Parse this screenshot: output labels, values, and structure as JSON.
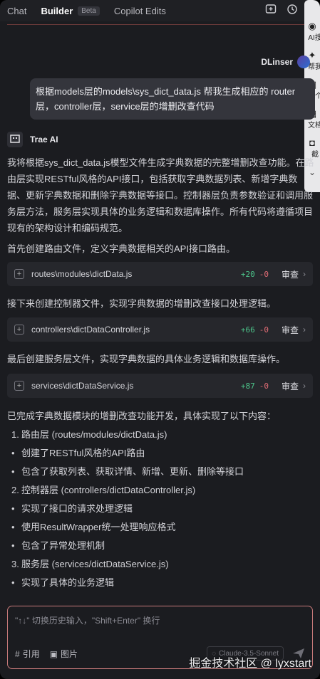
{
  "tabs": [
    {
      "label": "Chat"
    },
    {
      "label": "Builder",
      "badge": "Beta"
    },
    {
      "label": "Copilot Edits"
    }
  ],
  "top_icons": [
    "add-chat-icon",
    "history-icon"
  ],
  "side_panel": {
    "items": [
      {
        "icon": "ai-icon",
        "label": "AI搜"
      },
      {
        "icon": "help-icon",
        "label": "帮我"
      },
      {
        "icon": "image-icon",
        "label": "修个"
      },
      {
        "icon": "doc-icon",
        "label": "文档"
      },
      {
        "icon": "camera-icon",
        "label": "截"
      }
    ]
  },
  "user": {
    "name": "DLinser",
    "message": "根据models层的models\\sys_dict_data.js 帮我生成相应的 router层，controller层，service层的增删改查代码"
  },
  "assistant": {
    "name": "Trae AI",
    "intro": "我将根据sys_dict_data.js模型文件生成字典数据的完整增删改查功能。在路由层实现RESTful风格的API接口，包括获取字典数据列表、新增字典数据、更新字典数据和删除字典数据等接口。控制器层负责参数验证和调用服务层方法，服务层实现具体的业务逻辑和数据库操作。所有代码将遵循项目现有的架构设计和编码规范。",
    "step1": "首先创建路由文件，定义字典数据相关的API接口路由。",
    "step2": "接下来创建控制器文件，实现字典数据的增删改查接口处理逻辑。",
    "step3": "最后创建服务层文件，实现字典数据的具体业务逻辑和数据库操作。",
    "summary": "已完成字典数据模块的增删改查功能开发，具体实现了以下内容：",
    "files": [
      {
        "path": "routes\\modules\\dictData.js",
        "added": "+20",
        "removed": "-0",
        "action": "审查"
      },
      {
        "path": "controllers\\dictDataController.js",
        "added": "+66",
        "removed": "-0",
        "action": "审查"
      },
      {
        "path": "services\\dictDataService.js",
        "added": "+87",
        "removed": "-0",
        "action": "审查"
      }
    ],
    "list": [
      {
        "marker": "1.",
        "text": "路由层 (routes/modules/dictData.js)"
      },
      {
        "marker": "•",
        "text": "创建了RESTful风格的API路由"
      },
      {
        "marker": "•",
        "text": "包含了获取列表、获取详情、新增、更新、删除等接口"
      },
      {
        "marker": "2.",
        "text": "控制器层 (controllers/dictDataController.js)"
      },
      {
        "marker": "•",
        "text": "实现了接口的请求处理逻辑"
      },
      {
        "marker": "•",
        "text": "使用ResultWrapper统一处理响应格式"
      },
      {
        "marker": "•",
        "text": "包含了异常处理机制"
      },
      {
        "marker": "3.",
        "text": "服务层 (services/dictDataService.js)"
      },
      {
        "marker": "•",
        "text": "实现了具体的业务逻辑"
      }
    ]
  },
  "composer": {
    "placeholder": "\"↑↓\" 切换历史输入，\"Shift+Enter\" 换行",
    "tool_reference": "引用",
    "tool_image": "图片",
    "model": "Claude-3.5-Sonnet"
  },
  "watermark": "掘金技术社区 @ lyxstart",
  "colors": {
    "background": "#1b1c20",
    "diff_added": "#4cc38a",
    "diff_removed": "#e06c75",
    "composer_border": "#c87a7a"
  }
}
